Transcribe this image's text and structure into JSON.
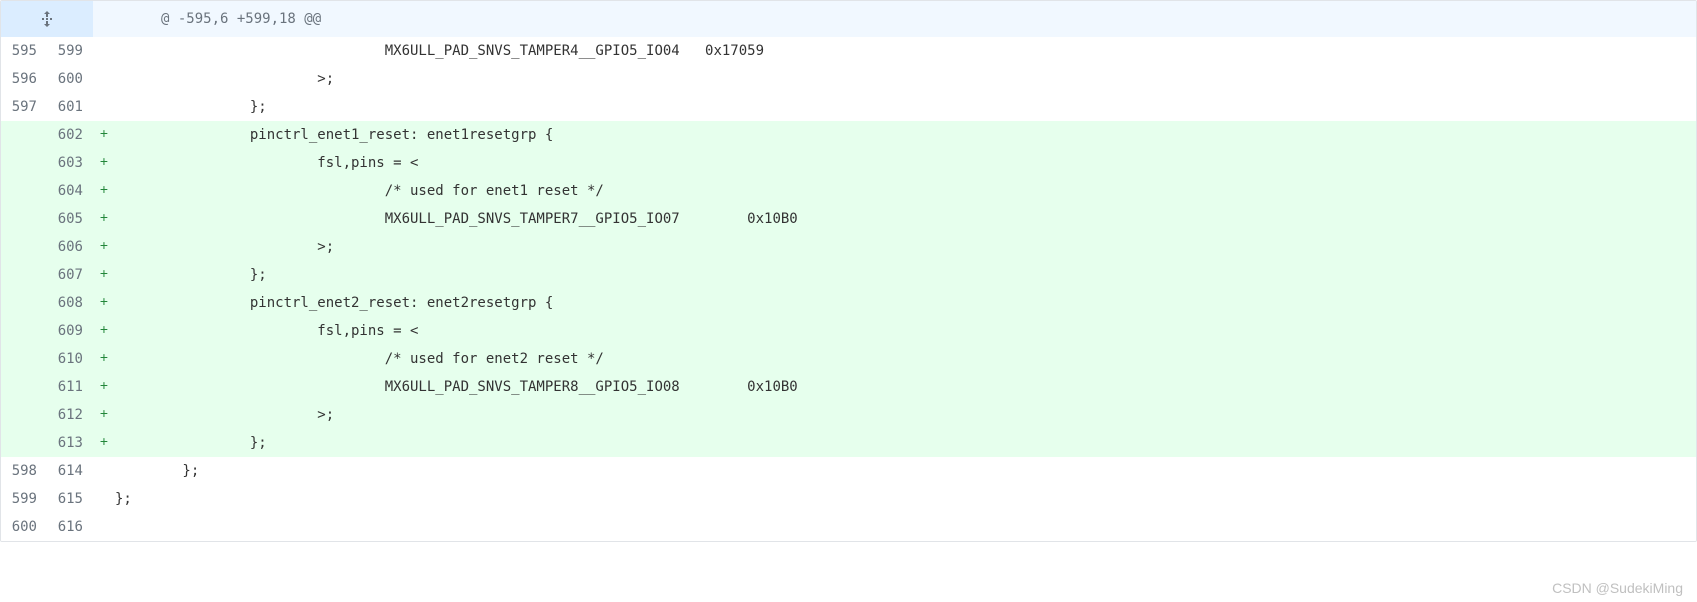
{
  "hunk": {
    "header": "@ -595,6 +599,18 @@"
  },
  "rows": [
    {
      "old": "595",
      "new": "599",
      "sign": "",
      "type": "ctx",
      "code": "                                MX6ULL_PAD_SNVS_TAMPER4__GPIO5_IO04   0x17059"
    },
    {
      "old": "596",
      "new": "600",
      "sign": "",
      "type": "ctx",
      "code": "                        >;"
    },
    {
      "old": "597",
      "new": "601",
      "sign": "",
      "type": "ctx",
      "code": "                };"
    },
    {
      "old": "",
      "new": "602",
      "sign": "+",
      "type": "added",
      "code": "                pinctrl_enet1_reset: enet1resetgrp {"
    },
    {
      "old": "",
      "new": "603",
      "sign": "+",
      "type": "added",
      "code": "                        fsl,pins = <"
    },
    {
      "old": "",
      "new": "604",
      "sign": "+",
      "type": "added",
      "code": "                                /* used for enet1 reset */"
    },
    {
      "old": "",
      "new": "605",
      "sign": "+",
      "type": "added",
      "code": "                                MX6ULL_PAD_SNVS_TAMPER7__GPIO5_IO07        0x10B0"
    },
    {
      "old": "",
      "new": "606",
      "sign": "+",
      "type": "added",
      "code": "                        >;"
    },
    {
      "old": "",
      "new": "607",
      "sign": "+",
      "type": "added",
      "code": "                };"
    },
    {
      "old": "",
      "new": "608",
      "sign": "+",
      "type": "added",
      "code": "                pinctrl_enet2_reset: enet2resetgrp {"
    },
    {
      "old": "",
      "new": "609",
      "sign": "+",
      "type": "added",
      "code": "                        fsl,pins = <"
    },
    {
      "old": "",
      "new": "610",
      "sign": "+",
      "type": "added",
      "code": "                                /* used for enet2 reset */"
    },
    {
      "old": "",
      "new": "611",
      "sign": "+",
      "type": "added",
      "code": "                                MX6ULL_PAD_SNVS_TAMPER8__GPIO5_IO08        0x10B0"
    },
    {
      "old": "",
      "new": "612",
      "sign": "+",
      "type": "added",
      "code": "                        >;"
    },
    {
      "old": "",
      "new": "613",
      "sign": "+",
      "type": "added",
      "code": "                };"
    },
    {
      "old": "598",
      "new": "614",
      "sign": "",
      "type": "ctx",
      "code": "        };"
    },
    {
      "old": "599",
      "new": "615",
      "sign": "",
      "type": "ctx",
      "code": "};"
    },
    {
      "old": "600",
      "new": "616",
      "sign": "",
      "type": "ctx",
      "code": ""
    }
  ],
  "watermark": "CSDN @SudekiMing"
}
